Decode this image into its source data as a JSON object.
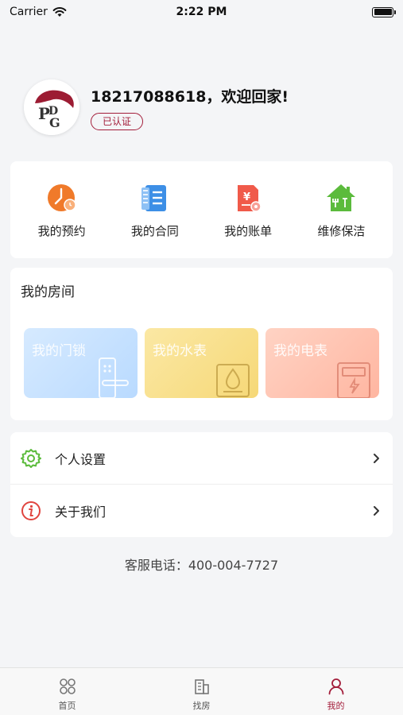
{
  "status_bar": {
    "carrier": "Carrier",
    "time": "2:22 PM"
  },
  "profile": {
    "welcome": "18217088618，欢迎回家!",
    "badge": "已认证",
    "avatar_logo_text": "PDG"
  },
  "quick_actions": [
    {
      "label": "我的预约",
      "icon": "clock-icon",
      "color": "#f07a2a"
    },
    {
      "label": "我的合同",
      "icon": "contract-icon",
      "color": "#3d8fe6"
    },
    {
      "label": "我的账单",
      "icon": "bill-icon",
      "color": "#f05a4a"
    },
    {
      "label": "维修保洁",
      "icon": "house-repair-icon",
      "color": "#5bbb3c"
    }
  ],
  "rooms": {
    "title": "我的房间",
    "tiles": [
      {
        "label": "我的门锁",
        "icon": "door-lock-icon"
      },
      {
        "label": "我的水表",
        "icon": "water-meter-icon"
      },
      {
        "label": "我的电表",
        "icon": "electric-meter-icon"
      }
    ]
  },
  "settings_list": [
    {
      "label": "个人设置",
      "icon": "gear-icon",
      "color": "#5bbb3c"
    },
    {
      "label": "关于我们",
      "icon": "info-icon",
      "color": "#e0453f"
    }
  ],
  "service_phone": "客服电话：400-004-7727",
  "tabs": [
    {
      "label": "首页",
      "icon": "home-grid-icon",
      "active": false
    },
    {
      "label": "找房",
      "icon": "building-icon",
      "active": false
    },
    {
      "label": "我的",
      "icon": "person-icon",
      "active": true
    }
  ],
  "colors": {
    "brand": "#a31d3a",
    "background": "#f4f5f7"
  }
}
